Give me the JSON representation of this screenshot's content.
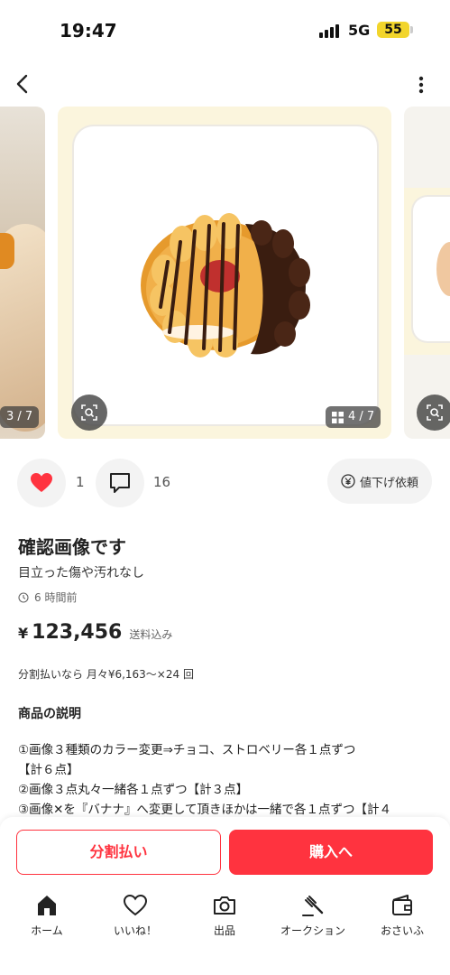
{
  "status_bar": {
    "time": "19:47",
    "network": "5G",
    "battery": "55"
  },
  "gallery": {
    "prev_counter": "3 / 7",
    "main_counter": "4 / 7"
  },
  "actions": {
    "like_count": "1",
    "comment_count": "16",
    "price_drop_label": "値下げ依頼"
  },
  "item": {
    "title": "確認画像です",
    "condition": "目立った傷や汚れなし",
    "posted": "6 時間前",
    "price_symbol": "¥",
    "price": "123,456",
    "shipping_note": "送料込み",
    "installment": "分割払いなら 月々¥6,163〜×24 回",
    "description_heading": "商品の説明",
    "description_lines": [
      "①画像３種類のカラー変更⇒チョコ、ストロベリー各１点ずつ",
      "【計６点】",
      "②画像３点丸々一緒各１点ずつ【計３点】",
      "③画像✕を『バナナ』へ変更して頂きほかは一緒で各１点ずつ【計４"
    ]
  },
  "purchase": {
    "split_label": "分割払い",
    "buy_label": "購入へ"
  },
  "colors": {
    "accent": "#ff333f",
    "heart": "#ff333f",
    "battery": "#f2d52c"
  },
  "nav": [
    {
      "label": "ホーム",
      "icon": "home-icon"
    },
    {
      "label": "いいね！",
      "icon": "heart-outline-icon"
    },
    {
      "label": "出品",
      "icon": "camera-icon"
    },
    {
      "label": "オークション",
      "icon": "gavel-icon"
    },
    {
      "label": "おさいふ",
      "icon": "wallet-icon"
    }
  ]
}
